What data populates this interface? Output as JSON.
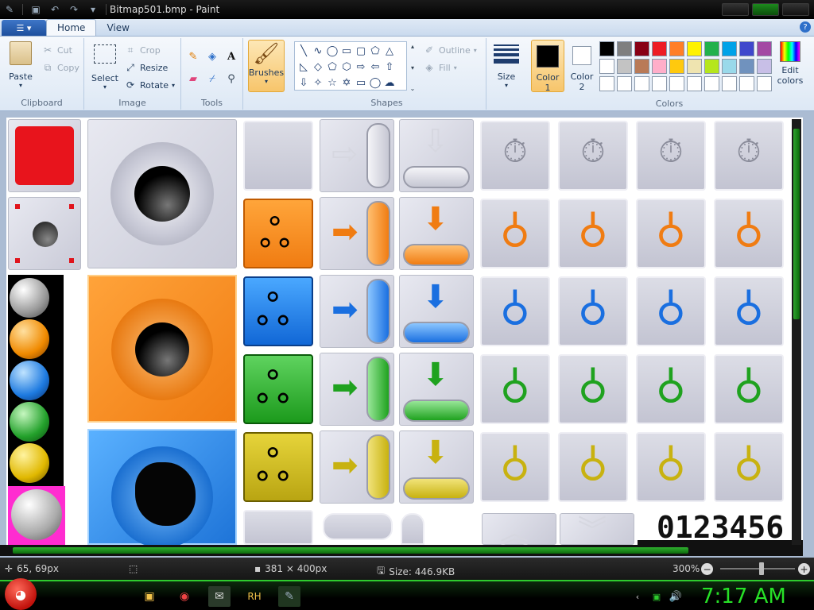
{
  "titlebar": {
    "title": "Bitmap501.bmp - Paint"
  },
  "tabs": [
    {
      "label": "Home",
      "active": true
    },
    {
      "label": "View",
      "active": false
    }
  ],
  "ribbon": {
    "clipboard": {
      "paste": "Paste",
      "cut": "Cut",
      "copy": "Copy",
      "label": "Clipboard"
    },
    "image": {
      "select": "Select",
      "crop": "Crop",
      "resize": "Resize",
      "rotate": "Rotate",
      "label": "Image"
    },
    "tools": {
      "label": "Tools"
    },
    "brushes": "Brushes",
    "shapes": {
      "outline": "Outline",
      "fill": "Fill",
      "label": "Shapes"
    },
    "size": "Size",
    "color1": {
      "line1": "Color",
      "line2": "1"
    },
    "color2": {
      "line1": "Color",
      "line2": "2"
    },
    "edit_colors": {
      "line1": "Edit",
      "line2": "colors"
    },
    "colors_label": "Colors",
    "palette_row1": [
      "#000000",
      "#7f7f7f",
      "#880015",
      "#ed1c24",
      "#ff7f27",
      "#fff200",
      "#22b14c",
      "#00a2e8",
      "#3f48cc",
      "#a349a4"
    ],
    "palette_row2": [
      "#ffffff",
      "#c3c3c3",
      "#b97a57",
      "#ffaec9",
      "#ffc90e",
      "#efe4b0",
      "#b5e61d",
      "#99d9ea",
      "#7092be",
      "#c8bfe7"
    ],
    "palette_row3": [
      "#ffffff",
      "#ffffff",
      "#ffffff",
      "#ffffff",
      "#ffffff",
      "#ffffff",
      "#ffffff",
      "#ffffff",
      "#ffffff",
      "#ffffff"
    ]
  },
  "canvas": {
    "digits": "0123456"
  },
  "status": {
    "cursor_pos": "65, 69px",
    "dimensions": "381 × 400px",
    "size": "Size: 446.9KB",
    "zoom": "300%"
  },
  "taskbar": {
    "clock": "7:17 AM",
    "rh": "RH"
  }
}
